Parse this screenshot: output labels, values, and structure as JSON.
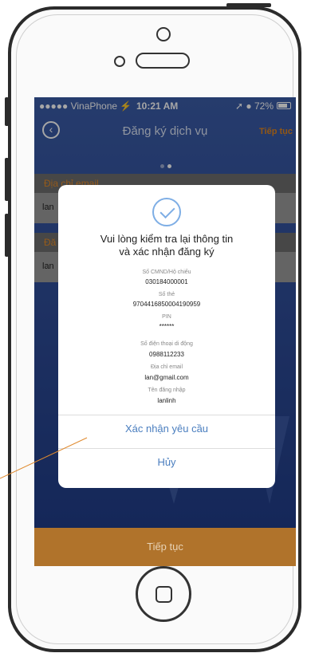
{
  "status_bar": {
    "carrier": "●●●●● VinaPhone ⚡",
    "time": "10:21 AM",
    "right": "➚ ● 72%"
  },
  "nav": {
    "back_icon": "back-circle-icon",
    "title": "Đăng ký dịch vụ",
    "next": "Tiếp tục"
  },
  "form": {
    "email_label": "Địa chỉ email",
    "email_value": "lan",
    "second_label": "Đă",
    "second_value": "lan"
  },
  "dialog": {
    "title_line1": "Vui lòng kiểm tra lại thông tin",
    "title_line2": "và xác nhận đăng ký",
    "fields": [
      {
        "label": "Số CMND/Hộ chiếu",
        "value": "030184000001"
      },
      {
        "label": "Số thẻ",
        "value": "9704416850004190959"
      },
      {
        "label": "PIN",
        "value": "******"
      },
      {
        "label": "Số điện thoại di động",
        "value": "0988112233"
      },
      {
        "label": "Địa chỉ email",
        "value": "lan@gmail.com"
      },
      {
        "label": "Tên đăng nhập",
        "value": "lanlinh"
      }
    ],
    "confirm": "Xác nhận yêu cầu",
    "cancel": "Hủy"
  },
  "footer": {
    "button": "Tiếp tục"
  },
  "colors": {
    "accent_orange": "#e0861f",
    "link_blue": "#4a7ebf",
    "screen_blue": "#2e4c97"
  }
}
